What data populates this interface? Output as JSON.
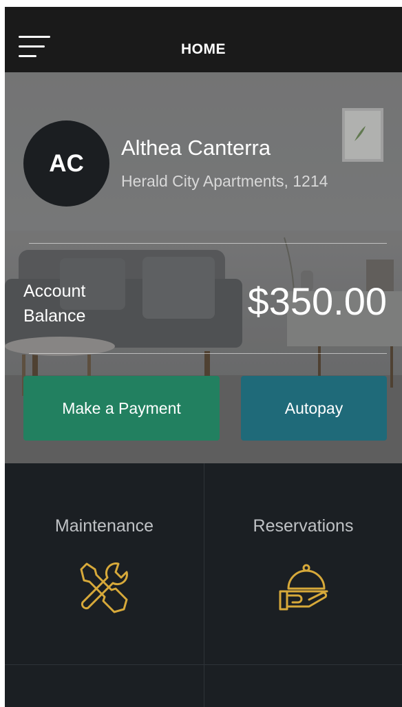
{
  "header": {
    "title": "HOME",
    "menu_icon": "hamburger-menu-icon"
  },
  "profile": {
    "initials": "AC",
    "name": "Althea Canterra",
    "address": "Herald City Apartments, 1214"
  },
  "balance": {
    "label": "Account Balance",
    "amount": "$350.00"
  },
  "actions": {
    "payment_label": "Make a Payment",
    "autopay_label": "Autopay"
  },
  "tiles": [
    {
      "label": "Maintenance",
      "icon": "wrench-screwdriver-icon"
    },
    {
      "label": "Reservations",
      "icon": "service-cloche-icon"
    }
  ],
  "colors": {
    "topbar": "#1a1a1a",
    "payment_button": "#228060",
    "autopay_button": "#1f6a79",
    "tile_background": "#1b1f23",
    "icon_gold": "#d7a93a"
  }
}
